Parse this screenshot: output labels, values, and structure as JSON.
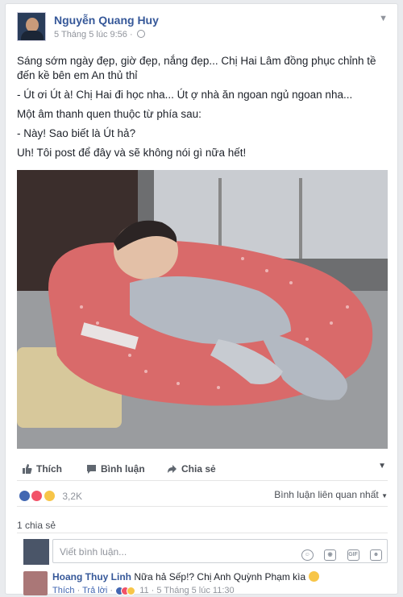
{
  "post": {
    "author": "Nguyễn Quang Huy",
    "timestamp": "5 Tháng 5 lúc 9:56 ·",
    "paragraphs": [
      "Sáng sớm ngày đẹp, giờ đẹp, nắng đẹp... Chị Hai Lâm đồng phục chỉnh tề đến kề bên em An thủ thỉ",
      "- Út ơi Út à! Chị Hai đi học nha... Út ợ nhà ăn ngoan ngủ ngoan nha...",
      "Một âm thanh quen thuộc từ phía sau:",
      "- Này! Sao biết là Út hả?",
      "Uh! Tôi post để đây và sẽ không nói gì nữa hết!"
    ]
  },
  "actions": {
    "like": "Thích",
    "comment": "Bình luận",
    "share": "Chia sẻ"
  },
  "reactions": {
    "count": "3,2K",
    "sort": "Bình luận liên quan nhất"
  },
  "shares": "1 chia sẻ",
  "comment_input": {
    "placeholder": "Viết bình luận...",
    "icons": [
      "emoji-icon",
      "camera-icon",
      "gif-icon",
      "sticker-icon"
    ]
  },
  "comment": {
    "author": "Hoang Thuy Linh",
    "text": "Nữa hả Sếp!? Chị Anh Quỳnh Phạm kìa",
    "like": "Thích",
    "reply": "Trả lời",
    "reaction_count": "11",
    "time": "5 Tháng 5 lúc 11:30"
  },
  "colors": {
    "link": "#365899",
    "like_blue": "#4267b2",
    "love_red": "#f25268",
    "haha_yellow": "#f7c548"
  }
}
